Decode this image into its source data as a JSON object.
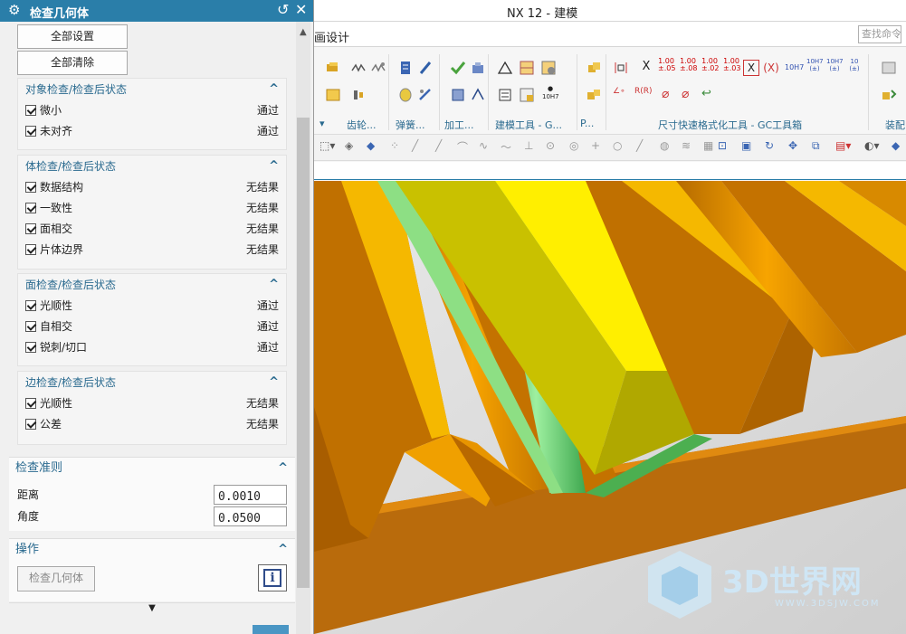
{
  "window": {
    "title": "NX 12 - 建模"
  },
  "dialog": {
    "title": "检查几何体",
    "buttons": {
      "set_all": "全部设置",
      "clear_all": "全部清除",
      "check": "检查几何体"
    },
    "groups": [
      {
        "title": "对象检查/检查后状态",
        "items": [
          {
            "label": "微小",
            "status": "通过"
          },
          {
            "label": "未对齐",
            "status": "通过"
          }
        ]
      },
      {
        "title": "体检查/检查后状态",
        "items": [
          {
            "label": "数据结构",
            "status": "无结果"
          },
          {
            "label": "一致性",
            "status": "无结果"
          },
          {
            "label": "面相交",
            "status": "无结果"
          },
          {
            "label": "片体边界",
            "status": "无结果"
          }
        ]
      },
      {
        "title": "面检查/检查后状态",
        "items": [
          {
            "label": "光顺性",
            "status": "通过"
          },
          {
            "label": "自相交",
            "status": "通过"
          },
          {
            "label": "锐刺/切口",
            "status": "通过"
          }
        ]
      },
      {
        "title": "边检查/检查后状态",
        "items": [
          {
            "label": "光顺性",
            "status": "无结果"
          },
          {
            "label": "公差",
            "status": "无结果"
          }
        ]
      }
    ],
    "criteria": {
      "title": "检查准则",
      "distance_label": "距离",
      "distance_value": "0.0010",
      "angle_label": "角度",
      "angle_value": "0.0500"
    },
    "operation": {
      "title": "操作"
    }
  },
  "ribbon": {
    "tab": "画设计",
    "search_placeholder": "查找命令",
    "groups": [
      "齿轮...",
      "弹簧...",
      "加工...",
      "建模工具 - G...",
      "P...",
      "尺寸快速格式化工具 - GC工具箱",
      "装配"
    ],
    "dim_labels": [
      "X",
      "(X)",
      "10H7"
    ]
  },
  "watermark": {
    "text": "3D世界网",
    "url": "WWW.3DSJW.COM"
  }
}
